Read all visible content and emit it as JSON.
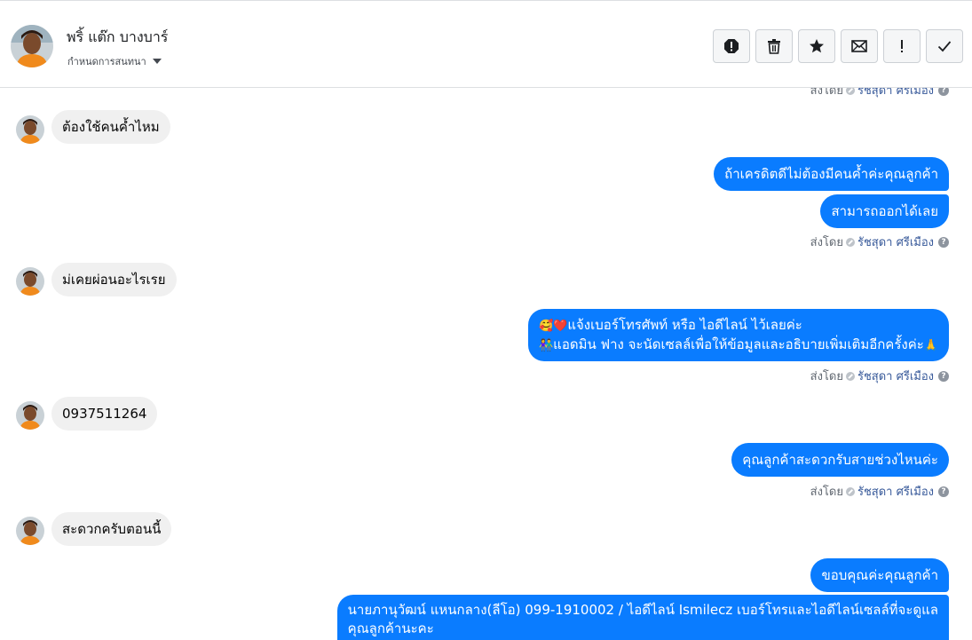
{
  "header": {
    "name": "พริ้ แต๊ก บางบาร์",
    "subtitle": "กำหนดการสนทนา",
    "actions": [
      {
        "icon": "alert-circle-icon",
        "label": "spam"
      },
      {
        "icon": "trash-icon",
        "label": "delete"
      },
      {
        "icon": "star-icon",
        "label": "follow-up"
      },
      {
        "icon": "envelope-icon",
        "label": "mark-unread"
      },
      {
        "icon": "exclamation-icon",
        "label": "important"
      },
      {
        "icon": "check-icon",
        "label": "done"
      }
    ]
  },
  "sent_by": {
    "prefix": "ส่งโดย",
    "agent": "รัชสุดา ศรีเมือง"
  },
  "messages": {
    "m1": "ต้องใช้คนค้ำไหม",
    "m2": "ถ้าเครดิตดีไม่ต้องมีคนค้ำค่ะคุณลูกค้า",
    "m3": "สามารถออกได้เลย",
    "m4": "ม่เคยผ่อนอะไรเรย",
    "m5_line1": "แจ้งเบอร์โทรศัพท์ หรือ ไอดีไลน์  ไว้เลยค่ะ",
    "m5_line2": "แอดมิน ฟาง จะนัดเซลล์เพื่อให้ข้อมูลและอธิบายเพิ่มเติมอีกครั้งค่ะ",
    "m6": "0937511264",
    "m7": "คุณลูกค้าสะดวกรับสายช่วงไหนค่ะ",
    "m8": "สะดวกครับตอนนี้",
    "m9": "ขอบคุณค่ะคุณลูกค้า",
    "m10_line1": "นายภานุวัฒน์ แหนกลาง(ลีโอ)      099-1910002 / ไอดีไลน์ Ismilecz   เบอร์โทรและไอดีไลน์เซลล์ที่จะดูแล",
    "m10_line2": "คุณลูกค้านะคะ"
  },
  "emojis": {
    "m5_a": "🥰",
    "m5_b": "❤️",
    "m5_c": "👫",
    "m5_d": "🙏"
  },
  "colors": {
    "outgoing_bubble": "#0a7cff",
    "incoming_bubble": "#f0f0f0",
    "agent_link": "#365899"
  }
}
